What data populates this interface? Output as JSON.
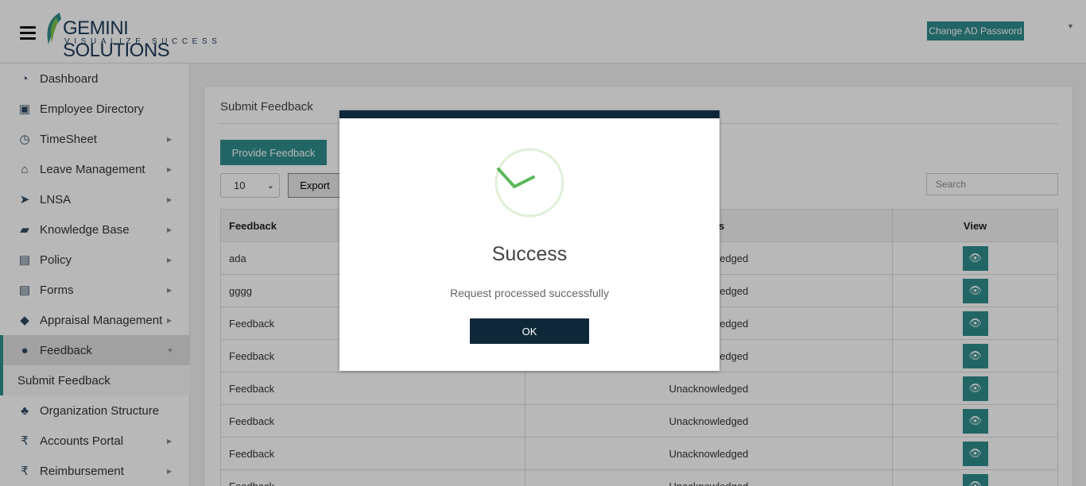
{
  "header": {
    "brand": "GEMINI SOLUTIONS",
    "tagline": "VISUALIZE SUCCESS",
    "change_password": "Change AD Password"
  },
  "sidebar": {
    "items": [
      {
        "label": "Dashboard",
        "icon": "dashboard-icon"
      },
      {
        "label": "Employee Directory",
        "icon": "contact-book-icon"
      },
      {
        "label": "TimeSheet",
        "icon": "clock-icon"
      },
      {
        "label": "Leave Management",
        "icon": "home-icon"
      },
      {
        "label": "LNSA",
        "icon": "paper-plane-icon"
      },
      {
        "label": "Knowledge Base",
        "icon": "folder-icon"
      },
      {
        "label": "Policy",
        "icon": "document-icon"
      },
      {
        "label": "Forms",
        "icon": "document-icon"
      },
      {
        "label": "Appraisal Management",
        "icon": "graduation-cap-icon"
      },
      {
        "label": "Feedback",
        "icon": "comments-icon"
      },
      {
        "label": "Submit Feedback"
      },
      {
        "label": "Organization Structure",
        "icon": "org-chart-icon"
      },
      {
        "label": "Accounts Portal",
        "icon": "rupee-icon"
      },
      {
        "label": "Reimbursement",
        "icon": "rupee-icon"
      }
    ]
  },
  "main": {
    "title": "Submit Feedback",
    "provide_button": "Provide Feedback",
    "page_size": "10",
    "export_button": "Export",
    "search_placeholder": "Search",
    "columns": [
      "Feedback",
      "Status",
      "View"
    ],
    "rows": [
      {
        "feedback": "ada",
        "status": "Unacknowledged"
      },
      {
        "feedback": "gggg",
        "status": "Unacknowledged"
      },
      {
        "feedback": "Feedback",
        "status": "Unacknowledged"
      },
      {
        "feedback": "Feedback",
        "status": "Unacknowledged"
      },
      {
        "feedback": "Feedback",
        "status": "Unacknowledged"
      },
      {
        "feedback": "Feedback",
        "status": "Unacknowledged"
      },
      {
        "feedback": "Feedback",
        "status": "Unacknowledged"
      },
      {
        "feedback": "Feedback",
        "status": "Unacknowledged"
      }
    ]
  },
  "modal": {
    "title": "Success",
    "message": "Request processed successfully",
    "ok_button": "OK"
  },
  "colors": {
    "accent": "#2f8e8c",
    "modal_dark": "#0e2839",
    "success_green": "#5cb85c"
  }
}
